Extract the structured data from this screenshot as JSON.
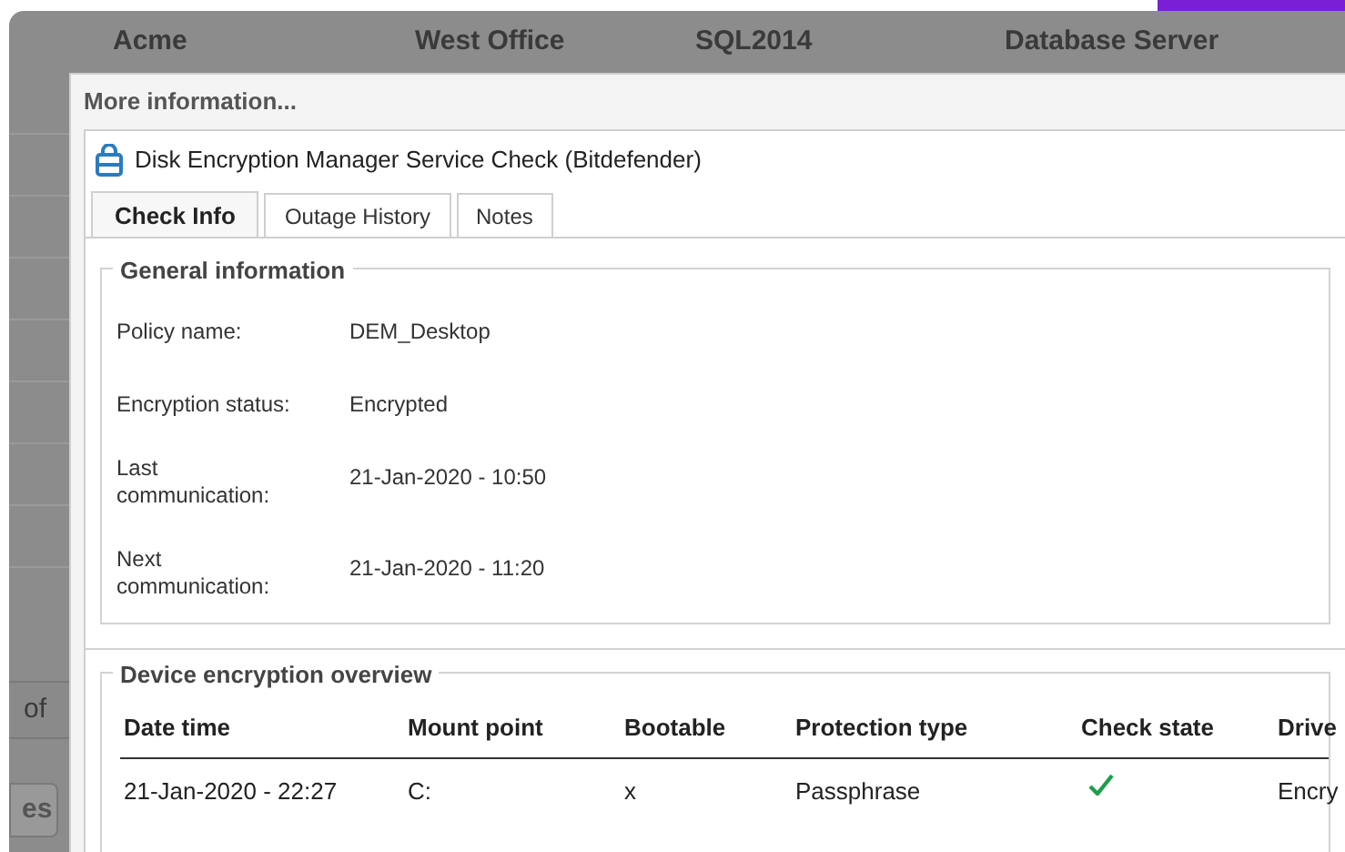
{
  "background_row": [
    "Acme",
    "West Office",
    "SQL2014",
    "Database Server"
  ],
  "background_side": {
    "pager_text": "of",
    "button": "es"
  },
  "dialog": {
    "title": "More information...",
    "check_title": "Disk Encryption Manager Service Check (Bitdefender)",
    "tabs": [
      {
        "label": "Check Info",
        "selected": true
      },
      {
        "label": "Outage History",
        "selected": false
      },
      {
        "label": "Notes",
        "selected": false
      }
    ],
    "general": {
      "title": "General information",
      "fields": [
        {
          "label": "Policy name:",
          "value": "DEM_Desktop"
        },
        {
          "label": "Encryption status:",
          "value": "Encrypted"
        },
        {
          "label": "Last communication:",
          "value": "21-Jan-2020 - 10:50"
        },
        {
          "label": "Next communication:",
          "value": "21-Jan-2020 - 11:20"
        }
      ]
    },
    "overview": {
      "title": "Device encryption overview",
      "columns": [
        "Date time",
        "Mount point",
        "Bootable",
        "Protection type",
        "Check state",
        "Drive"
      ],
      "rows": [
        {
          "date_time": "21-Jan-2020 - 22:27",
          "mount_point": "C:",
          "bootable": "x",
          "protection_type": "Passphrase",
          "check_ok": true,
          "column_6": "Encry"
        }
      ]
    }
  }
}
